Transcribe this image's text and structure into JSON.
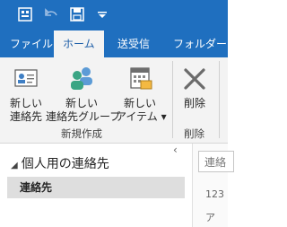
{
  "colors": {
    "accent": "#1f6fbf",
    "ribbon_bg": "#f3f3f3",
    "active_tab_text": "#1f5fa8"
  },
  "quick_access": {
    "icons": [
      "navigation-icon",
      "undo-icon",
      "save-icon",
      "customize-dropdown-icon"
    ]
  },
  "tabs": [
    {
      "label": "ファイル"
    },
    {
      "label": "ホーム"
    },
    {
      "label": "送受信"
    },
    {
      "label": "フォルダー"
    }
  ],
  "ribbon": {
    "new_contact": "新しい\n連絡先",
    "new_group": "新しい\n連絡先グループ",
    "new_item": "新しい\nアイテム ▾",
    "new_group_label": "新規作成",
    "delete": "削除",
    "delete_group_label": "削除"
  },
  "folder_pane": {
    "header": "個人用の連絡先",
    "items": [
      {
        "label": "連絡先"
      }
    ]
  },
  "content": {
    "search_placeholder": "連絡",
    "index": [
      "123",
      "ア"
    ]
  }
}
